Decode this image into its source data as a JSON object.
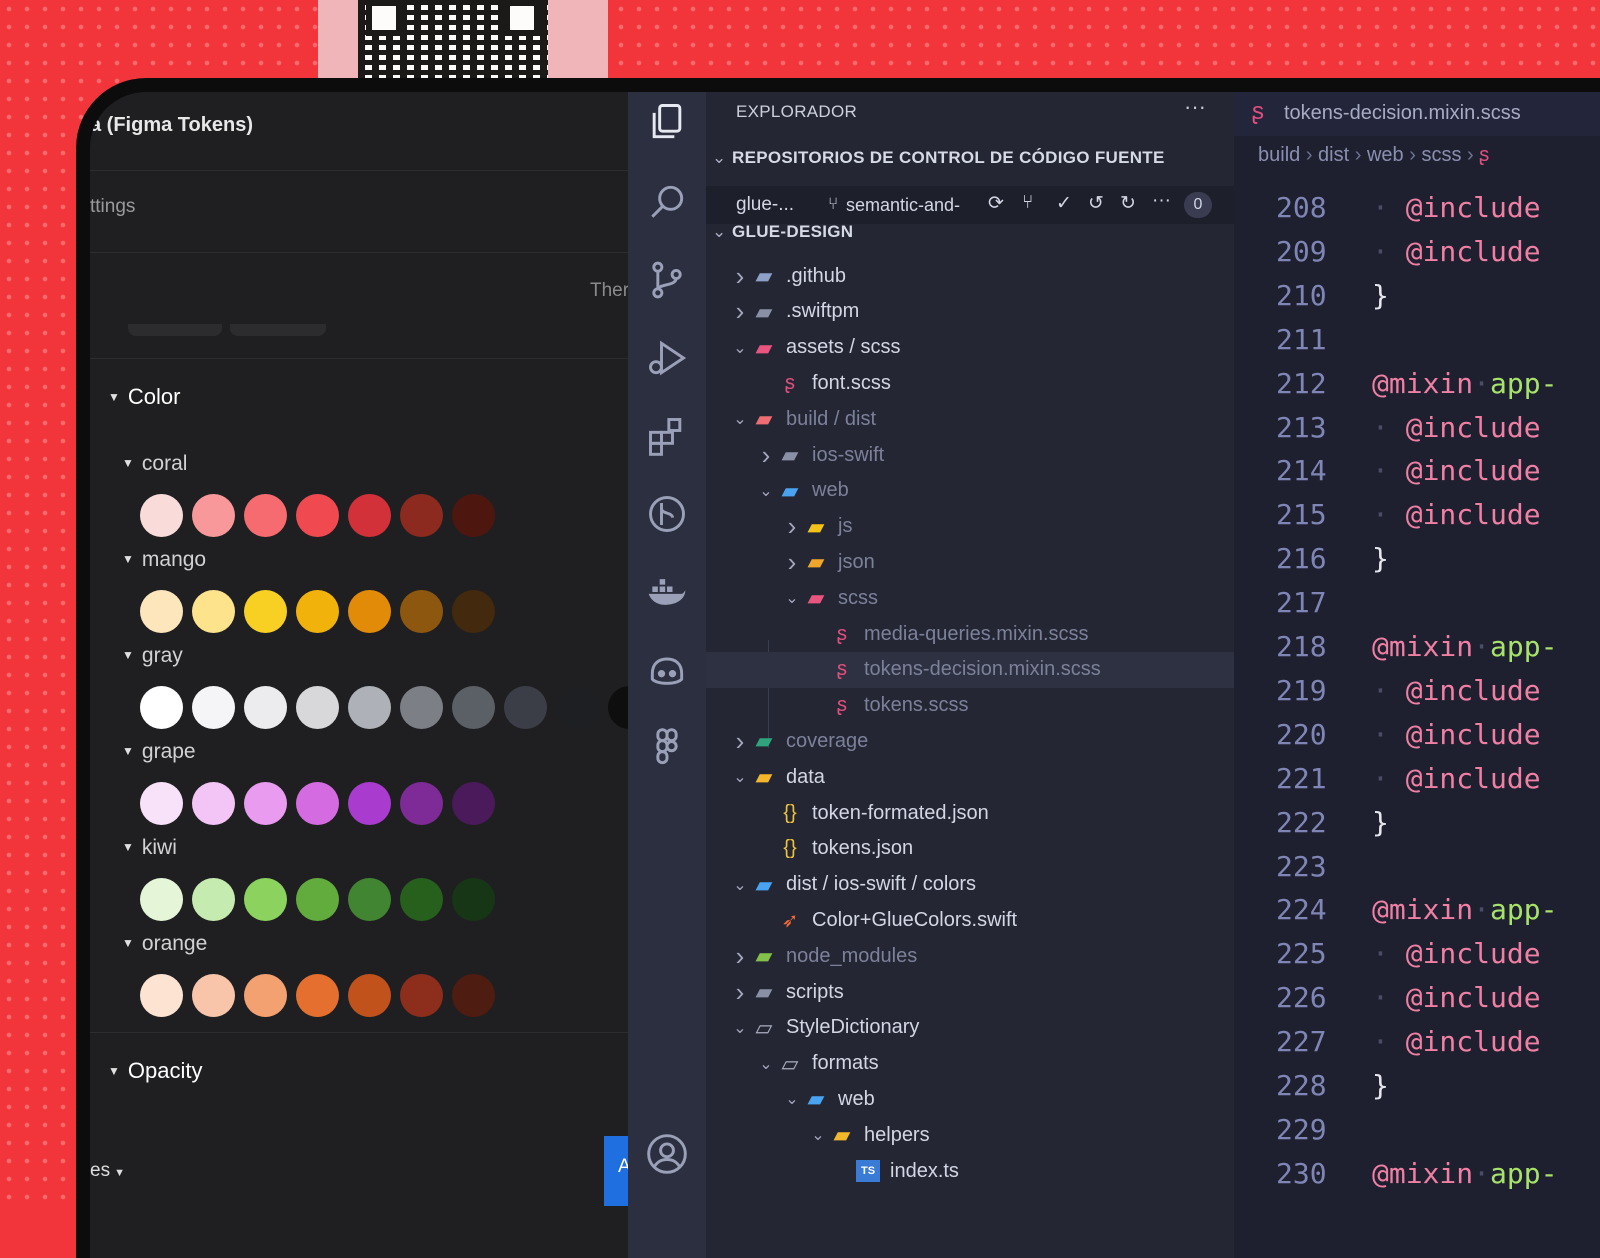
{
  "figma": {
    "title": "a (Figma Tokens)",
    "settings_label": "ttings",
    "theme_label": "Ther",
    "color_section": "Color",
    "opacity_section": "Opacity",
    "bottom_left": "es",
    "apply_button": "Ap",
    "groups": [
      {
        "name": "coral",
        "colors": [
          "#f9dcd9",
          "#f8989a",
          "#f66b70",
          "#f04a50",
          "#d3313a",
          "#8c2a20",
          "#4d1710"
        ]
      },
      {
        "name": "mango",
        "colors": [
          "#fde5bc",
          "#fde38c",
          "#f8d024",
          "#f2b20c",
          "#e28b09",
          "#8e5710",
          "#43290d"
        ]
      },
      {
        "name": "gray",
        "colors": [
          "#ffffff",
          "#f5f5f7",
          "#ececee",
          "#d8d8da",
          "#aeb2b8",
          "#7c7f86",
          "#5b5f66",
          "#3c3e47",
          "#1e1f22",
          "#0e0e0f"
        ]
      },
      {
        "name": "grape",
        "colors": [
          "#f8e2fa",
          "#f3c5f6",
          "#e89bef",
          "#d56be0",
          "#a93ccf",
          "#7e2a97",
          "#4a1a5b"
        ]
      },
      {
        "name": "kiwi",
        "colors": [
          "#e4f5d8",
          "#c6ebb0",
          "#8bd25f",
          "#62ac3e",
          "#418532",
          "#275f1d",
          "#163615"
        ]
      },
      {
        "name": "orange",
        "colors": [
          "#fce3d2",
          "#f8c5aa",
          "#f3a170",
          "#e46f2e",
          "#c2521c",
          "#8d2d1b",
          "#4e1c10"
        ]
      }
    ]
  },
  "explorer": {
    "header": "EXPLORADOR",
    "more": "···",
    "scm_section": "REPOSITORIOS DE CONTROL DE CÓDIGO FUENTE",
    "scm_repo": "glue-...",
    "scm_branch": "semantic-and-",
    "scm_count": "0",
    "workspace": "GLUE-DESIGN",
    "items": [
      {
        "label": ".github",
        "chev": ">",
        "icon": "folder-github-icon",
        "depth": 0,
        "dim": false
      },
      {
        "label": ".swiftpm",
        "chev": ">",
        "icon": "folder-icon",
        "depth": 0,
        "dim": false
      },
      {
        "label": "assets / scss",
        "chev": "v",
        "icon": "folder-scss-icon",
        "depth": 0,
        "dim": false
      },
      {
        "label": "font.scss",
        "chev": "",
        "icon": "sass-file-icon",
        "depth": 1,
        "dim": false
      },
      {
        "label": "build / dist",
        "chev": "v",
        "icon": "folder-build-icon",
        "depth": 0,
        "dim": true
      },
      {
        "label": "ios-swift",
        "chev": ">",
        "icon": "folder-icon",
        "depth": 1,
        "dim": true
      },
      {
        "label": "web",
        "chev": "v",
        "icon": "folder-web-icon",
        "depth": 1,
        "dim": true
      },
      {
        "label": "js",
        "chev": ">",
        "icon": "folder-js-icon",
        "depth": 2,
        "dim": true
      },
      {
        "label": "json",
        "chev": ">",
        "icon": "folder-json-icon",
        "depth": 2,
        "dim": true
      },
      {
        "label": "scss",
        "chev": "v",
        "icon": "folder-scss-icon",
        "depth": 2,
        "dim": true
      },
      {
        "label": "media-queries.mixin.scss",
        "chev": "",
        "icon": "sass-file-icon",
        "depth": 3,
        "dim": true
      },
      {
        "label": "tokens-decision.mixin.scss",
        "chev": "",
        "icon": "sass-file-icon",
        "depth": 3,
        "dim": true
      },
      {
        "label": "tokens.scss",
        "chev": "",
        "icon": "sass-file-icon",
        "depth": 3,
        "dim": true
      },
      {
        "label": "coverage",
        "chev": ">",
        "icon": "folder-coverage-icon",
        "depth": 0,
        "dim": true
      },
      {
        "label": "data",
        "chev": "v",
        "icon": "folder-data-icon",
        "depth": 0,
        "dim": false
      },
      {
        "label": "token-formated.json",
        "chev": "",
        "icon": "json-file-icon",
        "depth": 1,
        "dim": false
      },
      {
        "label": "tokens.json",
        "chev": "",
        "icon": "json-file-icon",
        "depth": 1,
        "dim": false
      },
      {
        "label": "dist / ios-swift / colors",
        "chev": "v",
        "icon": "folder-web-icon",
        "depth": 0,
        "dim": false
      },
      {
        "label": "Color+GlueColors.swift",
        "chev": "",
        "icon": "swift-file-icon",
        "depth": 1,
        "dim": false
      },
      {
        "label": "node_modules",
        "chev": ">",
        "icon": "folder-node-icon",
        "depth": 0,
        "dim": true
      },
      {
        "label": "scripts",
        "chev": ">",
        "icon": "folder-scripts-icon",
        "depth": 0,
        "dim": false
      },
      {
        "label": "StyleDictionary",
        "chev": "v",
        "icon": "folder-open-icon",
        "depth": 0,
        "dim": false
      },
      {
        "label": "formats",
        "chev": "v",
        "icon": "folder-open-icon",
        "depth": 1,
        "dim": false
      },
      {
        "label": "web",
        "chev": "v",
        "icon": "folder-web-icon",
        "depth": 2,
        "dim": false
      },
      {
        "label": "helpers",
        "chev": "v",
        "icon": "folder-helpers-icon",
        "depth": 3,
        "dim": false
      },
      {
        "label": "index.ts",
        "chev": "",
        "icon": "typescript-file-icon",
        "depth": 4,
        "dim": false
      }
    ]
  },
  "editor": {
    "tab": "tokens-decision.mixin.scss",
    "breadcrumb": [
      "build",
      "dist",
      "web",
      "scss"
    ],
    "lines": [
      {
        "n": "208",
        "kind": "include",
        "text": "@include"
      },
      {
        "n": "209",
        "kind": "include",
        "text": "@include"
      },
      {
        "n": "210",
        "kind": "brace",
        "text": "}"
      },
      {
        "n": "211",
        "kind": "blank",
        "text": ""
      },
      {
        "n": "212",
        "kind": "mixin",
        "text": "@mixin",
        "name": "app-"
      },
      {
        "n": "213",
        "kind": "include",
        "text": "@include"
      },
      {
        "n": "214",
        "kind": "include",
        "text": "@include"
      },
      {
        "n": "215",
        "kind": "include",
        "text": "@include"
      },
      {
        "n": "216",
        "kind": "brace",
        "text": "}"
      },
      {
        "n": "217",
        "kind": "blank",
        "text": ""
      },
      {
        "n": "218",
        "kind": "mixin",
        "text": "@mixin",
        "name": "app-"
      },
      {
        "n": "219",
        "kind": "include",
        "text": "@include"
      },
      {
        "n": "220",
        "kind": "include",
        "text": "@include"
      },
      {
        "n": "221",
        "kind": "include",
        "text": "@include"
      },
      {
        "n": "222",
        "kind": "brace",
        "text": "}"
      },
      {
        "n": "223",
        "kind": "blank",
        "text": ""
      },
      {
        "n": "224",
        "kind": "mixin",
        "text": "@mixin",
        "name": "app-"
      },
      {
        "n": "225",
        "kind": "include",
        "text": "@include"
      },
      {
        "n": "226",
        "kind": "include",
        "text": "@include"
      },
      {
        "n": "227",
        "kind": "include",
        "text": "@include"
      },
      {
        "n": "228",
        "kind": "brace",
        "text": "}"
      },
      {
        "n": "229",
        "kind": "blank",
        "text": ""
      },
      {
        "n": "230",
        "kind": "mixin",
        "text": "@mixin",
        "name": "app-"
      }
    ]
  }
}
